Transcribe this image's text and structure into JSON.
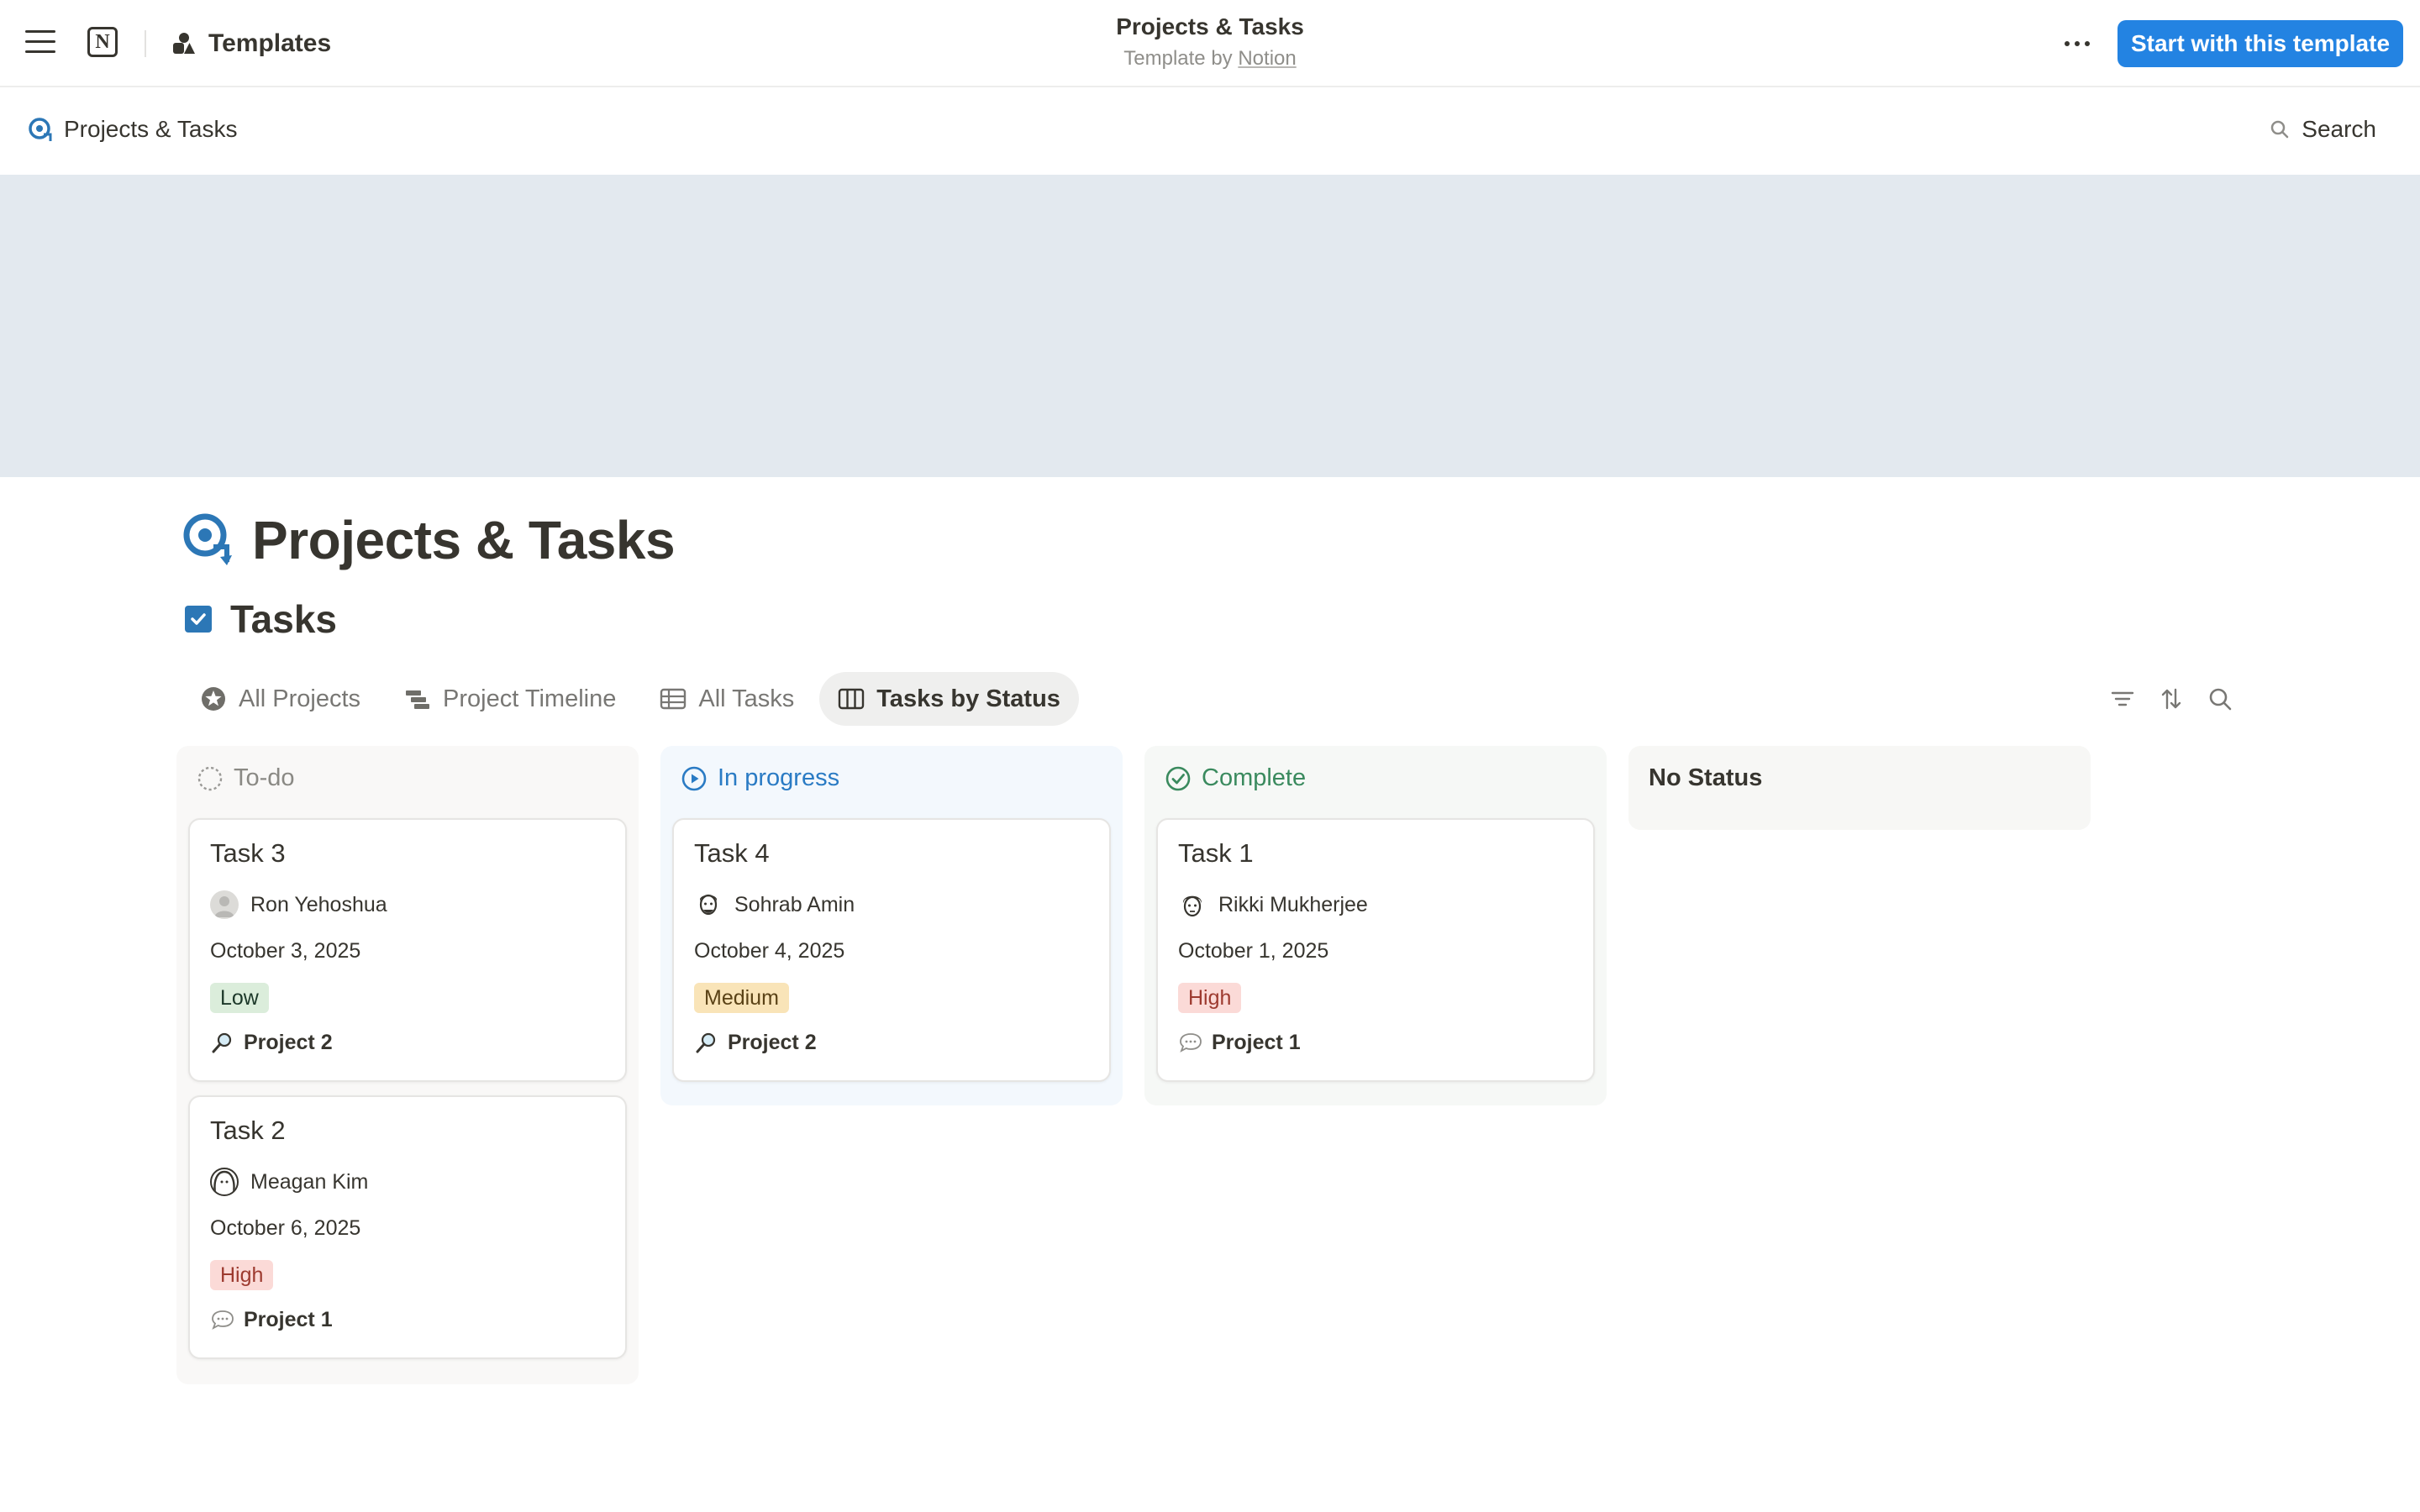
{
  "topbar": {
    "templates_label": "Templates",
    "title": "Projects & Tasks",
    "subtitle_prefix": "Template by ",
    "subtitle_author": "Notion",
    "start_button": "Start with this template",
    "notion_logo_letter": "N"
  },
  "breadcrumb": {
    "page": "Projects & Tasks",
    "search_label": "Search"
  },
  "page": {
    "title": "Projects & Tasks",
    "database_title": "Tasks"
  },
  "views": [
    {
      "label": "All Projects",
      "icon": "star-circle-icon"
    },
    {
      "label": "Project Timeline",
      "icon": "timeline-icon"
    },
    {
      "label": "All Tasks",
      "icon": "table-icon"
    },
    {
      "label": "Tasks by Status",
      "icon": "board-icon",
      "active": true
    }
  ],
  "columns": {
    "todo": {
      "label": "To-do",
      "color": "#8a8984",
      "cards": [
        {
          "title": "Task 3",
          "person": "Ron Yehoshua",
          "date": "October 3, 2025",
          "priority": "Low",
          "project": "Project 2",
          "project_icon": "magnifier-icon"
        },
        {
          "title": "Task 2",
          "person": "Meagan Kim",
          "date": "October 6, 2025",
          "priority": "High",
          "project": "Project 1",
          "project_icon": "speech-bubble-icon"
        }
      ]
    },
    "in_progress": {
      "label": "In progress",
      "color": "#2a7bc4",
      "cards": [
        {
          "title": "Task 4",
          "person": "Sohrab Amin",
          "date": "October 4, 2025",
          "priority": "Medium",
          "project": "Project 2",
          "project_icon": "magnifier-icon"
        }
      ]
    },
    "complete": {
      "label": "Complete",
      "color": "#3a8a5e",
      "cards": [
        {
          "title": "Task 1",
          "person": "Rikki Mukherjee",
          "date": "October 1, 2025",
          "priority": "High",
          "project": "Project 1",
          "project_icon": "speech-bubble-icon"
        }
      ]
    },
    "no_status": {
      "label": "No Status"
    }
  },
  "colors": {
    "accent": "#2383e2",
    "cover": "#e3e9ef",
    "low_tag_bg": "#dbeddb",
    "medium_tag_bg": "#f9e4b8",
    "high_tag_bg": "#fbdad7"
  }
}
